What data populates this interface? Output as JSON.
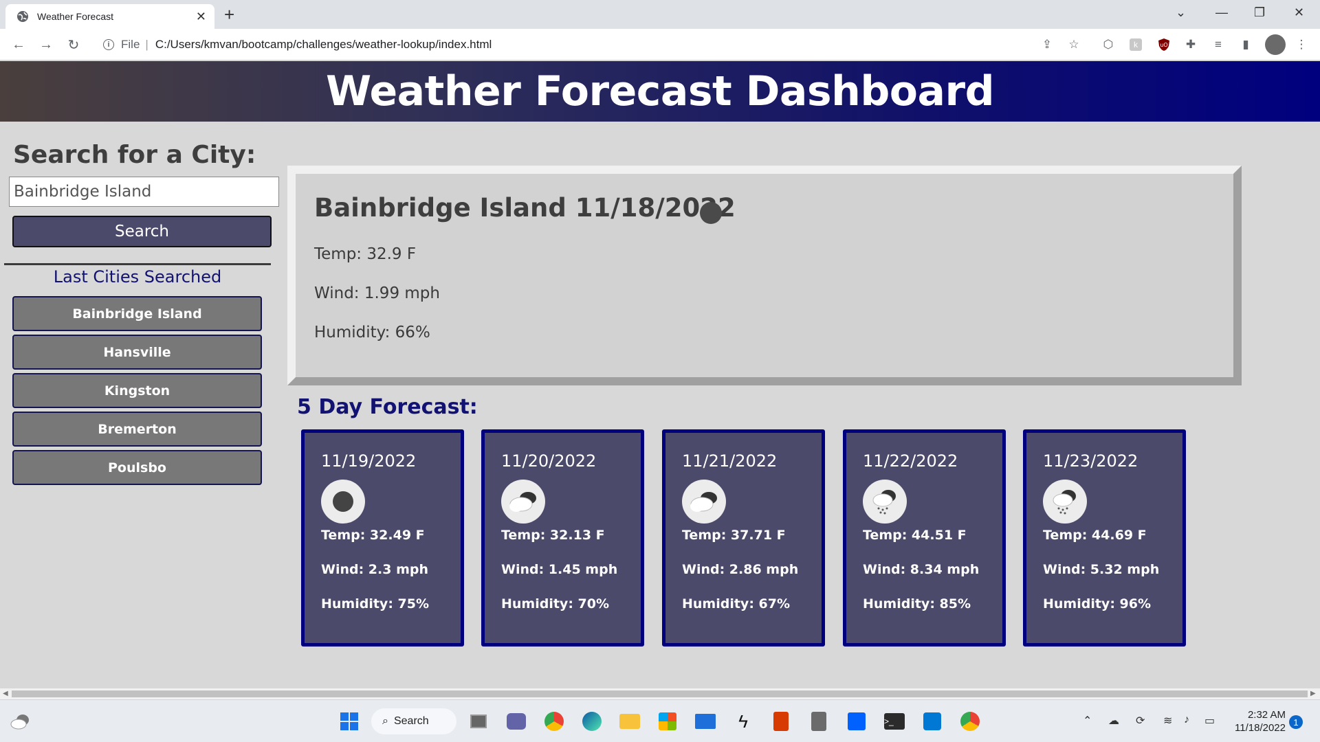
{
  "browser": {
    "tab_title": "Weather Forecast",
    "url_scheme": "File",
    "url": "C:/Users/kmvan/bootcamp/challenges/weather-lookup/index.html"
  },
  "page": {
    "header_title": "Weather Forecast Dashboard"
  },
  "sidebar": {
    "title": "Search for a City:",
    "search_value": "Bainbridge Island",
    "search_button": "Search",
    "history_title": "Last Cities Searched",
    "history": [
      {
        "label": "Bainbridge Island"
      },
      {
        "label": "Hansville"
      },
      {
        "label": "Kingston"
      },
      {
        "label": "Bremerton"
      },
      {
        "label": "Poulsbo"
      }
    ]
  },
  "current": {
    "title": "Bainbridge Island 11/18/2022",
    "icon": "dark-clear-icon",
    "temp": "Temp: 32.9 F",
    "wind": "Wind: 1.99 mph",
    "humidity": "Humidity: 66%"
  },
  "forecast": {
    "title": "5 Day Forecast:",
    "days": [
      {
        "date": "11/19/2022",
        "icon": "clear-night-icon",
        "temp": "Temp: 32.49 F",
        "wind": "Wind: 2.3 mph",
        "humidity": "Humidity: 75%"
      },
      {
        "date": "11/20/2022",
        "icon": "cloudy-icon",
        "temp": "Temp: 32.13 F",
        "wind": "Wind: 1.45 mph",
        "humidity": "Humidity: 70%"
      },
      {
        "date": "11/21/2022",
        "icon": "cloudy-icon",
        "temp": "Temp: 37.71 F",
        "wind": "Wind: 2.86 mph",
        "humidity": "Humidity: 67%"
      },
      {
        "date": "11/22/2022",
        "icon": "rain-icon",
        "temp": "Temp: 44.51 F",
        "wind": "Wind: 8.34 mph",
        "humidity": "Humidity: 85%"
      },
      {
        "date": "11/23/2022",
        "icon": "rain-icon",
        "temp": "Temp: 44.69 F",
        "wind": "Wind: 5.32 mph",
        "humidity": "Humidity: 96%"
      }
    ]
  },
  "taskbar": {
    "search_label": "Search",
    "time": "2:32 AM",
    "date": "11/18/2022",
    "notification_count": "1"
  }
}
